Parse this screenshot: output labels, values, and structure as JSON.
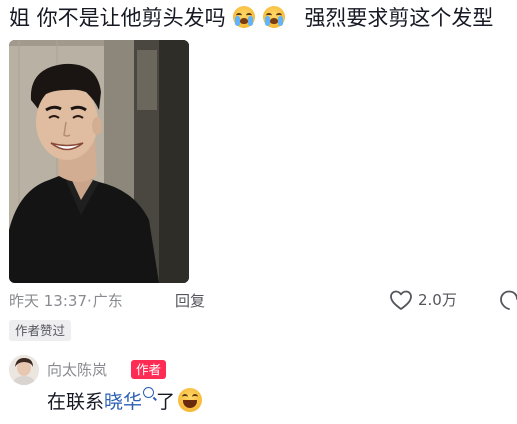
{
  "comment": {
    "part1": "姐 你不是让他剪头发吗",
    "emojis": [
      "cry-emoji",
      "cry-emoji"
    ],
    "part2": "强烈要求剪这个发型"
  },
  "photo": {
    "description_icon": "photo-portrait"
  },
  "meta": {
    "time": "昨天 13:37",
    "separator": "·",
    "location": "广东",
    "reply_label": "回复",
    "like_count": "2.0万"
  },
  "author_liked_label": "作者赞过",
  "reply": {
    "name": "向太陈岚",
    "author_tag": "作者",
    "text_before": "在联系",
    "mention": "晓华",
    "text_after": "了",
    "emoji": "laugh-emoji"
  },
  "colors": {
    "text_primary": "#161823",
    "text_secondary": "#8a8b91",
    "author_tag_bg": "#fe2c55",
    "mention": "#2b5fb4"
  }
}
